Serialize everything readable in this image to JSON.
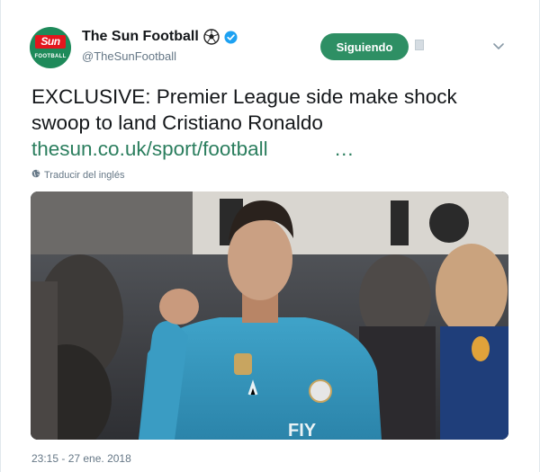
{
  "account": {
    "name": "The Sun Football",
    "handle": "@TheSunFootball",
    "avatar_brand_top": "Sun",
    "avatar_brand_bottom": "FOOTBALL"
  },
  "follow_button": {
    "label": "Siguiendo"
  },
  "tweet": {
    "text": "EXCLUSIVE: Premier League side make shock swoop to land Cristiano Ronaldo",
    "link": "thesun.co.uk/sport/football",
    "ellipsis": "…",
    "translate_label": "Traducir del inglés",
    "timestamp": "23:15 - 27 ene. 2018"
  },
  "photo": {
    "jersey_text": "FIY"
  },
  "colors": {
    "accent_green": "#2e8f64",
    "link_green": "#2b7e5e",
    "verified_blue": "#1da1f2",
    "muted": "#657786"
  },
  "icons": [
    "soccer-ball-icon",
    "verified-badge-icon",
    "chevron-down-icon",
    "globe-icon"
  ]
}
